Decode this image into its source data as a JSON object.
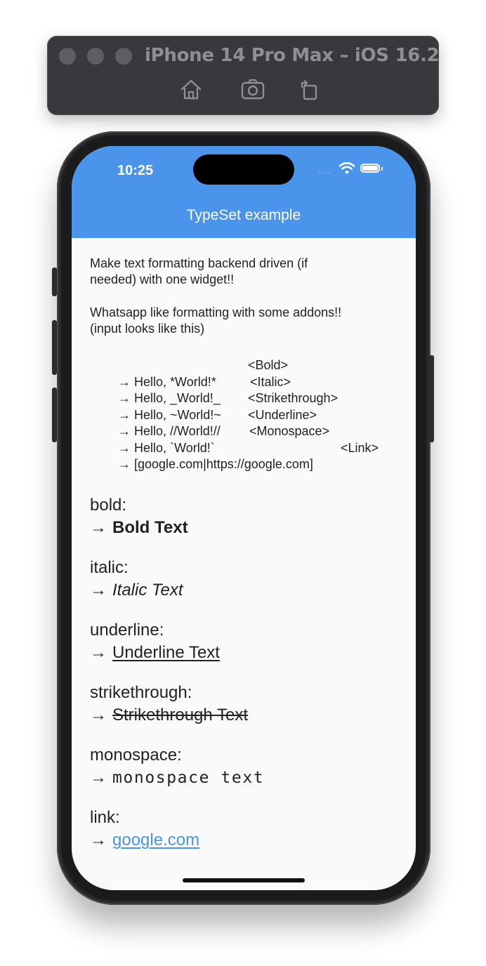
{
  "simulator": {
    "title": "iPhone 14 Pro Max – iOS 16.2",
    "icons": [
      "home-icon",
      "screenshot-icon",
      "rotate-icon"
    ]
  },
  "status_bar": {
    "time": "10:25",
    "signal": "....",
    "icons": [
      "wifi-icon",
      "battery-icon"
    ]
  },
  "app_bar": {
    "title": "TypeSet example",
    "color": "#4b94ec"
  },
  "intro": {
    "paragraph1": "Make text formatting backend driven (if\nneeded) with one widget!!",
    "paragraph2": "Whatsapp like formatting with some addons!!\n(input looks like this)"
  },
  "format_examples": [
    {
      "input": "→ Hello, *World!*",
      "tag": "<Bold>"
    },
    {
      "input": "→ Hello, _World!_",
      "tag": "<Italic>"
    },
    {
      "input": "→ Hello, ~World!~",
      "tag": "<Strikethrough>"
    },
    {
      "input": "→ Hello, //World!//",
      "tag": "<Underline>"
    },
    {
      "input": "→ Hello, `World!`",
      "tag": "<Monospace>"
    },
    {
      "input": "→ [google.com|https://google.com]",
      "tag": "<Link>"
    }
  ],
  "arrow": "→",
  "sections": {
    "bold": {
      "label": "bold:",
      "value": "Bold Text"
    },
    "italic": {
      "label": "italic:",
      "value": "Italic Text"
    },
    "underline": {
      "label": "underline:",
      "value": "Underline Text"
    },
    "strikethrough": {
      "label": "strikethrough:",
      "value": "Strikethrough Text"
    },
    "monospace": {
      "label": "monospace:",
      "value": "monospace text"
    },
    "link": {
      "label": "link:",
      "value": "google.com",
      "color": "#4b94ec"
    }
  }
}
